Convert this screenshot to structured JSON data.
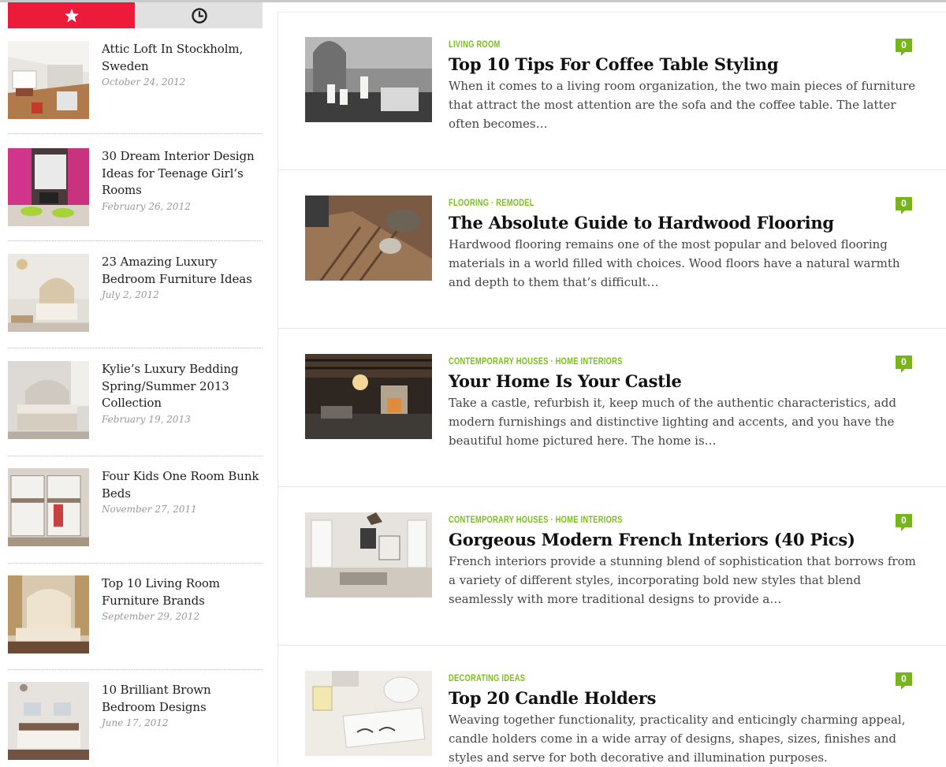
{
  "sidebar": {
    "tabs": [
      {
        "name": "popular",
        "icon": "star-icon",
        "active": true
      },
      {
        "name": "recent",
        "icon": "clock-icon",
        "active": false
      }
    ],
    "items": [
      {
        "title": "Attic Loft In Stockholm, Sweden",
        "date": "October 24, 2012"
      },
      {
        "title": "30 Dream Interior Design Ideas for Teenage Girl’s Rooms",
        "date": "February 26, 2012"
      },
      {
        "title": "23 Amazing Luxury Bedroom Furniture Ideas",
        "date": "July 2, 2012"
      },
      {
        "title": "Kylie’s Luxury Bedding Spring/Summer 2013 Collection",
        "date": "February 19, 2013"
      },
      {
        "title": "Four Kids One Room Bunk Beds",
        "date": "November 27, 2011"
      },
      {
        "title": "Top 10 Living Room Furniture Brands",
        "date": "September 29, 2012"
      },
      {
        "title": "10 Brilliant Brown Bedroom Designs",
        "date": "June 17, 2012"
      }
    ]
  },
  "articles": [
    {
      "category": "LIVING ROOM",
      "title": "Top 10 Tips For Coffee Table Styling",
      "excerpt": "When it comes to a living room organization, the two main pieces of furniture that attract the most attention are the sofa and the coffee table. The latter often becomes…",
      "comments": "0"
    },
    {
      "category": "FLOORING · REMODEL",
      "title": "The Absolute Guide to Hardwood Flooring",
      "excerpt": "Hardwood flooring remains one of the most popular and beloved flooring materials in a world filled with choices. Wood floors have a natural warmth and depth to them that’s difficult…",
      "comments": "0"
    },
    {
      "category": "CONTEMPORARY HOUSES · HOME INTERIORS",
      "title": "Your Home Is Your Castle",
      "excerpt": "Take a castle, refurbish it, keep much of the authentic characteristics, add modern furnishings and distinctive lighting and accents, and you have the beautiful home pictured here. The home is…",
      "comments": "0"
    },
    {
      "category": "CONTEMPORARY HOUSES · HOME INTERIORS",
      "title": "Gorgeous Modern French Interiors (40 Pics)",
      "excerpt": "French interiors provide a stunning blend of sophistication that borrows from a variety of different styles, incorporating bold new styles that blend seamlessly with more traditional designs to provide a…",
      "comments": "0"
    },
    {
      "category": "DECORATING IDEAS",
      "title": "Top 20 Candle Holders",
      "excerpt": "Weaving together functionality, practicality and enticingly charming appeal, candle holders come in a wide array of designs, shapes, sizes, finishes and styles and serve for both decorative and illumination purposes.",
      "comments": "0"
    }
  ],
  "colors": {
    "accent_red": "#ed1b3a",
    "category_green": "#7cbe1d",
    "comment_badge": "#78b51c"
  }
}
